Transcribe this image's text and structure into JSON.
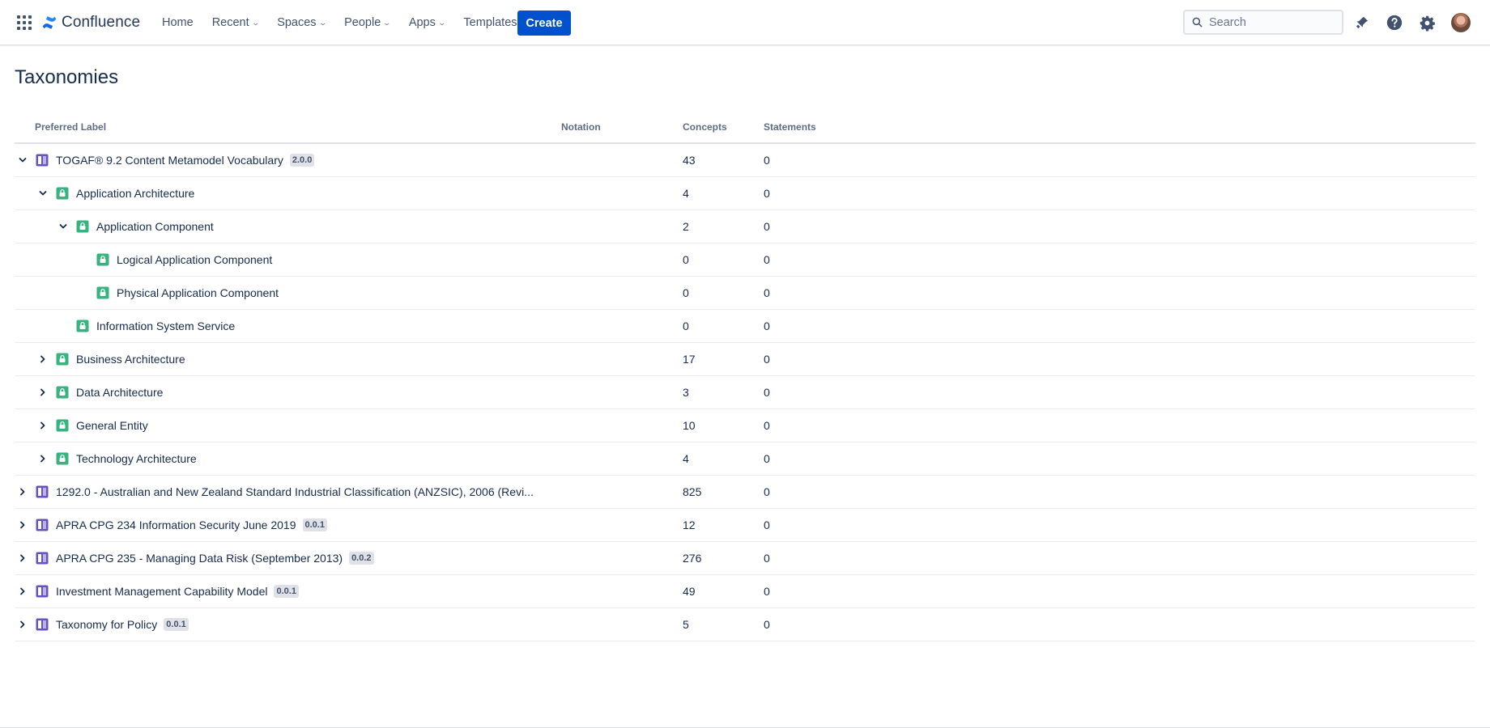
{
  "nav": {
    "brand": "Confluence",
    "items": [
      {
        "label": "Home",
        "dropdown": false
      },
      {
        "label": "Recent",
        "dropdown": true
      },
      {
        "label": "Spaces",
        "dropdown": true
      },
      {
        "label": "People",
        "dropdown": true
      },
      {
        "label": "Apps",
        "dropdown": true
      },
      {
        "label": "Templates",
        "dropdown": false
      }
    ],
    "create_label": "Create",
    "search_placeholder": "Search",
    "brand_color": "#0052CC"
  },
  "page": {
    "title": "Taxonomies"
  },
  "table": {
    "headers": {
      "preferred_label": "Preferred Label",
      "notation": "Notation",
      "concepts": "Concepts",
      "statements": "Statements"
    },
    "rows": [
      {
        "level": 0,
        "toggle": "expanded",
        "icon": "vocabulary-icon",
        "label": "TOGAF® 9.2 Content Metamodel Vocabulary",
        "badge": "2.0.0",
        "concepts": "43",
        "statements": "0"
      },
      {
        "level": 1,
        "toggle": "expanded",
        "icon": "concept-icon",
        "label": "Application Architecture",
        "badge": "",
        "concepts": "4",
        "statements": "0"
      },
      {
        "level": 2,
        "toggle": "expanded",
        "icon": "concept-icon",
        "label": "Application Component",
        "badge": "",
        "concepts": "2",
        "statements": "0"
      },
      {
        "level": 3,
        "toggle": "none",
        "icon": "concept-icon",
        "label": "Logical Application Component",
        "badge": "",
        "concepts": "0",
        "statements": "0"
      },
      {
        "level": 3,
        "toggle": "none",
        "icon": "concept-icon",
        "label": "Physical Application Component",
        "badge": "",
        "concepts": "0",
        "statements": "0"
      },
      {
        "level": 2,
        "toggle": "none",
        "icon": "concept-icon",
        "label": "Information System Service",
        "badge": "",
        "concepts": "0",
        "statements": "0"
      },
      {
        "level": 1,
        "toggle": "collapsed",
        "icon": "concept-icon",
        "label": "Business Architecture",
        "badge": "",
        "concepts": "17",
        "statements": "0"
      },
      {
        "level": 1,
        "toggle": "collapsed",
        "icon": "concept-icon",
        "label": "Data Architecture",
        "badge": "",
        "concepts": "3",
        "statements": "0"
      },
      {
        "level": 1,
        "toggle": "collapsed",
        "icon": "concept-icon",
        "label": "General Entity",
        "badge": "",
        "concepts": "10",
        "statements": "0"
      },
      {
        "level": 1,
        "toggle": "collapsed",
        "icon": "concept-icon",
        "label": "Technology Architecture",
        "badge": "",
        "concepts": "4",
        "statements": "0"
      },
      {
        "level": 0,
        "toggle": "collapsed",
        "icon": "vocabulary-icon",
        "label": "1292.0 - Australian and New Zealand Standard Industrial Classification (ANZSIC), 2006 (Revi...",
        "badge": "",
        "concepts": "825",
        "statements": "0"
      },
      {
        "level": 0,
        "toggle": "collapsed",
        "icon": "vocabulary-icon",
        "label": "APRA CPG 234 Information Security June 2019",
        "badge": "0.0.1",
        "concepts": "12",
        "statements": "0"
      },
      {
        "level": 0,
        "toggle": "collapsed",
        "icon": "vocabulary-icon",
        "label": "APRA CPG 235 - Managing Data Risk (September 2013)",
        "badge": "0.0.2",
        "concepts": "276",
        "statements": "0"
      },
      {
        "level": 0,
        "toggle": "collapsed",
        "icon": "vocabulary-icon",
        "label": "Investment Management Capability Model",
        "badge": "0.0.1",
        "concepts": "49",
        "statements": "0"
      },
      {
        "level": 0,
        "toggle": "collapsed",
        "icon": "vocabulary-icon",
        "label": "Taxonomy for Policy",
        "badge": "0.0.1",
        "concepts": "5",
        "statements": "0"
      }
    ]
  },
  "colors": {
    "vocabulary_icon": "#6554C0",
    "concept_icon": "#36B37E",
    "primary_button": "#0052CC"
  }
}
